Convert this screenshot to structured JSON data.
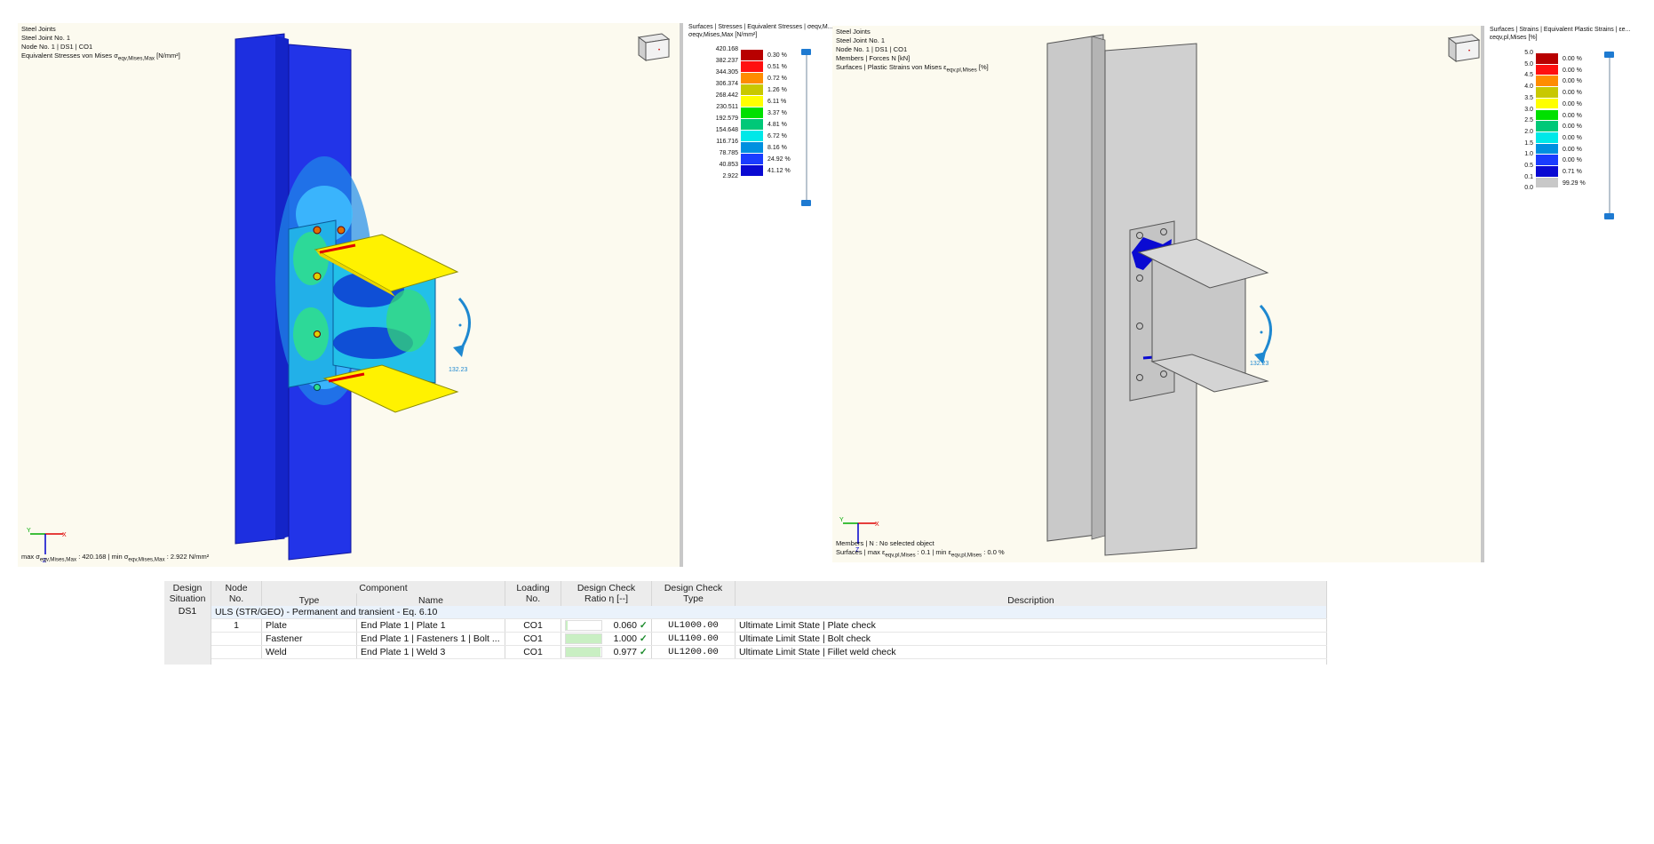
{
  "left_view": {
    "header": [
      "Steel Joints",
      "Steel Joint No. 1",
      "Node No. 1 | DS1 | CO1"
    ],
    "result_prefix": "Equivalent Stresses von Mises σ",
    "result_sub": "eqv,Mises,Max",
    "result_unit": " [N/mm²]",
    "footer_a": "max σ",
    "footer_sub_a": "eqv,Mises,Max",
    "footer_b": " : 420.168 | min σ",
    "footer_sub_b": "eqv,Mises,Max",
    "footer_c": " : 2.922 N/mm²",
    "moment_label": "132.23"
  },
  "left_legend": {
    "title": "Surfaces | Stresses | Equivalent Stresses | σeqv,M...",
    "subtitle": "σeqv,Mises,Max [N/mm²]",
    "values": [
      "420.168",
      "382.237",
      "344.305",
      "306.374",
      "268.442",
      "230.511",
      "192.579",
      "154.648",
      "116.716",
      "78.785",
      "40.853",
      "2.922"
    ],
    "colors": [
      "#b80000",
      "#ff1010",
      "#ff8c00",
      "#c8c800",
      "#ffff00",
      "#00e000",
      "#00c878",
      "#00e8e8",
      "#0090e0",
      "#1a3cff",
      "#0a0ad2"
    ],
    "percents": [
      "0.30 %",
      "0.51 %",
      "0.72 %",
      "1.26 %",
      "6.11 %",
      "3.37 %",
      "4.81 %",
      "6.72 %",
      "8.16 %",
      "24.92 %",
      "41.12 %"
    ]
  },
  "right_view": {
    "header": [
      "Steel Joints",
      "Steel Joint No. 1",
      "Node No. 1 | DS1 | CO1",
      "Members | Forces N [kN]"
    ],
    "result_prefix": "Surfaces | Plastic Strains von Mises ε",
    "result_sub": "eqv,pl,Mises",
    "result_unit": " [%]",
    "footer_line1": "Members | N : No selected object",
    "footer_a": "Surfaces | max ε",
    "footer_sub_a": "eqv,pl,Mises",
    "footer_b": " : 0.1 | min ε",
    "footer_sub_b": "eqv,pl,Mises",
    "footer_c": " : 0.0 %",
    "moment_label": "132.23"
  },
  "right_legend": {
    "title": "Surfaces | Strains | Equivalent Plastic Strains | εe...",
    "subtitle": "εeqv,pl,Mises [%]",
    "values": [
      "5.0",
      "5.0",
      "4.5",
      "4.0",
      "3.5",
      "3.0",
      "2.5",
      "2.0",
      "1.5",
      "1.0",
      "0.5",
      "0.1",
      "0.0"
    ],
    "colors": [
      "#b80000",
      "#ff1010",
      "#ff8c00",
      "#c8c800",
      "#ffff00",
      "#00e000",
      "#00c878",
      "#00e8e8",
      "#0090e0",
      "#1a3cff",
      "#0a0ad2",
      "#c8c8c8"
    ],
    "percents": [
      "0.00 %",
      "0.00 %",
      "0.00 %",
      "0.00 %",
      "0.00 %",
      "0.00 %",
      "0.00 %",
      "0.00 %",
      "0.00 %",
      "0.00 %",
      "0.71 %",
      "99.29 %"
    ]
  },
  "table": {
    "headers": {
      "design_situation": [
        "Design",
        "Situation"
      ],
      "node_no": [
        "Node",
        "No."
      ],
      "component": "Component",
      "type": "Type",
      "name": "Name",
      "loading_no": [
        "Loading",
        "No."
      ],
      "ratio": [
        "Design Check",
        "Ratio η [--]"
      ],
      "check_type": [
        "Design Check",
        "Type"
      ],
      "description": "Description"
    },
    "situation": "DS1",
    "group_label": "ULS (STR/GEO) - Permanent and transient - Eq. 6.10",
    "rows": [
      {
        "node": "1",
        "type": "Plate",
        "name": "End Plate 1 | Plate 1",
        "loading": "CO1",
        "ratio": "0.060",
        "ratio_value": 0.06,
        "check": "UL1000.00",
        "description": "Ultimate Limit State | Plate check"
      },
      {
        "node": "",
        "type": "Fastener",
        "name": "End Plate 1 | Fasteners 1 | Bolt ...",
        "loading": "CO1",
        "ratio": "1.000",
        "ratio_value": 1.0,
        "check": "UL1100.00",
        "description": "Ultimate Limit State | Bolt check"
      },
      {
        "node": "",
        "type": "Weld",
        "name": "End Plate 1 | Weld 3",
        "loading": "CO1",
        "ratio": "0.977",
        "ratio_value": 0.977,
        "check": "UL1200.00",
        "description": "Ultimate Limit State | Fillet weld check"
      }
    ]
  }
}
